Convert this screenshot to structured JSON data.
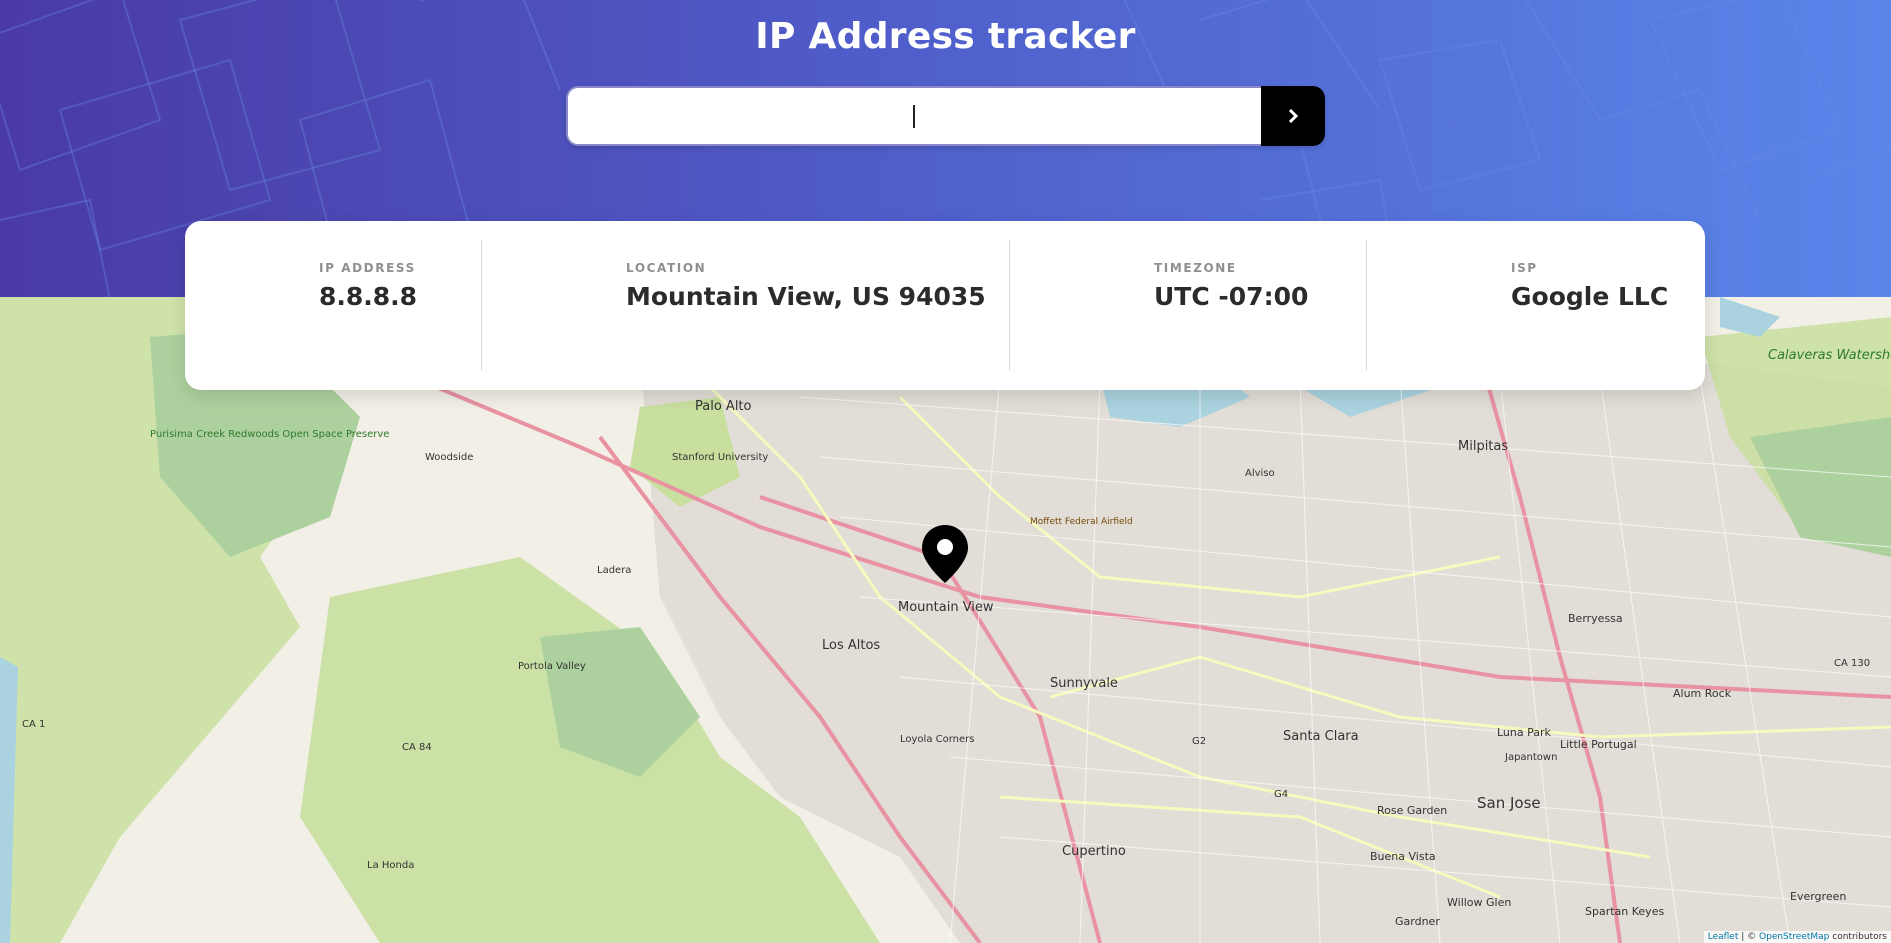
{
  "header": {
    "title": "IP Address tracker",
    "search_value": ""
  },
  "info": [
    {
      "label": "IP ADDRESS",
      "value": "8.8.8.8"
    },
    {
      "label": "LOCATION",
      "value": "Mountain View, US 94035"
    },
    {
      "label": "TIMEZONE",
      "value": "UTC -07:00"
    },
    {
      "label": "ISP",
      "value": "Google LLC"
    }
  ],
  "map": {
    "marker_icon": "map-pin-icon",
    "labels": {
      "palo_alto": "Palo Alto",
      "stanford": "Stanford University",
      "woodside": "Woodside",
      "milpitas": "Milpitas",
      "alviso": "Alviso",
      "moffett": "Moffett Federal Airfield",
      "mountain_view": "Mountain View",
      "los_altos": "Los Altos",
      "sunnyvale": "Sunnyvale",
      "santa_clara": "Santa Clara",
      "berryessa": "Berryessa",
      "alum_rock": "Alum Rock",
      "portola_valley": "Portola Valley",
      "ladera": "Ladera",
      "loyola_corners": "Loyola Corners",
      "luna_park": "Luna Park",
      "little_portugal": "Little Portugal",
      "japantown": "Japantown",
      "san_jose": "San Jose",
      "rose_garden": "Rose Garden",
      "cupertino": "Cupertino",
      "buena_vista": "Buena Vista",
      "willow_glen": "Willow Glen",
      "gardner": "Gardner",
      "spartan_keyes": "Spartan Keyes",
      "evergreen": "Evergreen",
      "la_honda": "La Honda",
      "calaveras": "Calaveras Watershed",
      "purisima": "Purisima Creek Redwoods Open Space Preserve",
      "ca1": "CA 1",
      "ca84": "CA 84",
      "ca130": "CA 130",
      "g2": "G2",
      "g4": "G4"
    },
    "attribution_leaflet": "Leaflet",
    "attribution_sep": " | © ",
    "attribution_osm": "OpenStreetMap",
    "attribution_tail": " contributors"
  },
  "colors": {
    "header_start": "#4a3aa5",
    "header_end": "#5a86ea",
    "button": "#000000",
    "water": "#aad3df",
    "park": "#c8df9e"
  }
}
